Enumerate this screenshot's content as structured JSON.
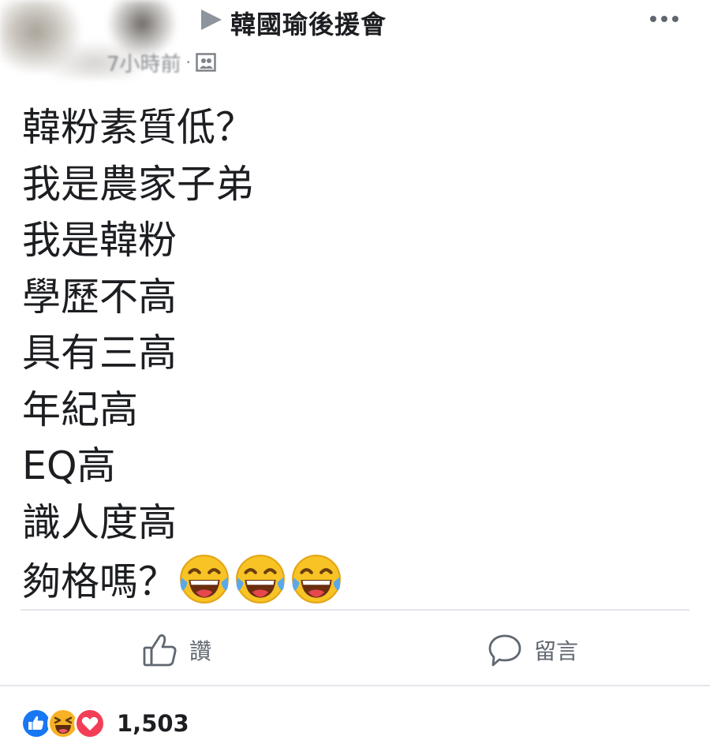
{
  "header": {
    "page_name": "韓國瑜後援會",
    "time": "7小時前",
    "dot": "·",
    "audience_icon": "group-audience-icon",
    "more_icon": "more-dots-icon"
  },
  "post": {
    "lines": [
      "韓粉素質低？",
      "我是農家子弟",
      "我是韓粉",
      "學歷不高",
      "具有三高",
      "年紀高",
      "EQ高",
      "識人度高"
    ],
    "last_line": "夠格嗎？",
    "emojis": [
      "tears-of-joy-icon",
      "tears-of-joy-icon",
      "tears-of-joy-icon"
    ]
  },
  "actions": {
    "like_label": "讚",
    "comment_label": "留言"
  },
  "reactions": {
    "icons": [
      "like-reaction-icon",
      "haha-reaction-icon",
      "love-reaction-icon"
    ],
    "count": "1,503"
  },
  "colors": {
    "text": "#1c1e21",
    "muted": "#606770",
    "like_blue": "#1877f2",
    "love_red": "#f33e58",
    "haha_yellow": "#f7b125"
  }
}
